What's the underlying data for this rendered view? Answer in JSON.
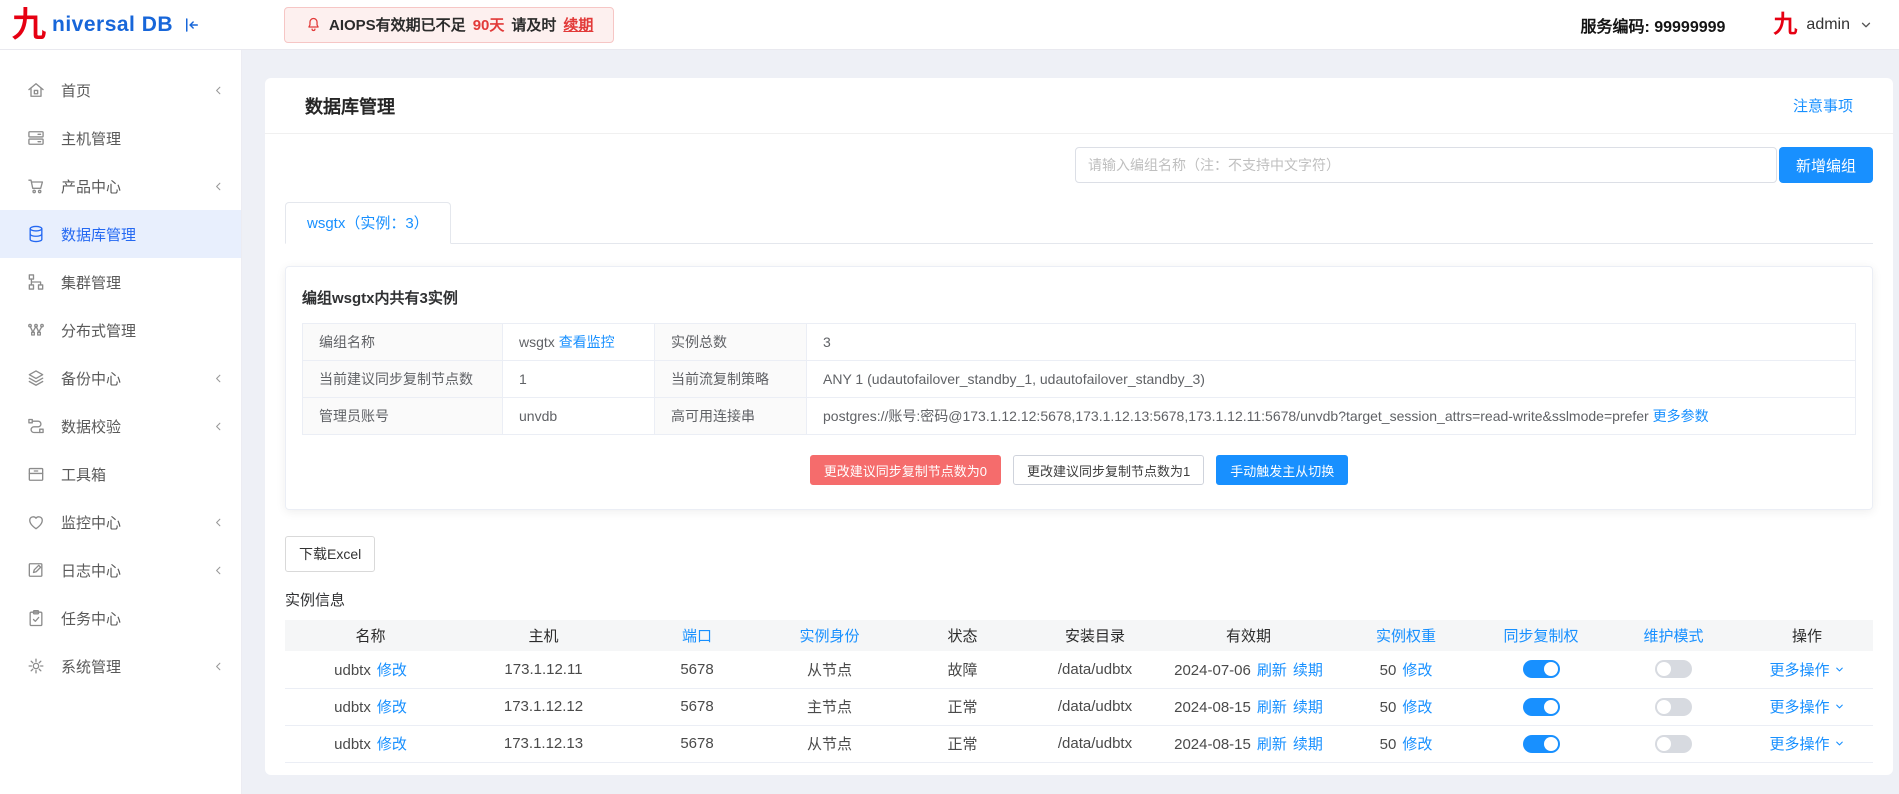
{
  "brand": {
    "logo_han": "九",
    "logo_text": "niversal DB"
  },
  "topbar": {
    "warning": {
      "icon": "bell-icon",
      "prefix": "AIOPS有效期已不足",
      "days": "90天",
      "mid": "请及时",
      "renew": "续期"
    },
    "service_code": "服务编码: 99999999",
    "user": {
      "logo_han": "九",
      "name": "admin"
    }
  },
  "sidebar": {
    "items": [
      {
        "id": "home",
        "label": "首页",
        "icon": "home-icon",
        "expandable": true,
        "active": false
      },
      {
        "id": "hosts",
        "label": "主机管理",
        "icon": "server-icon",
        "expandable": false,
        "active": false
      },
      {
        "id": "products",
        "label": "产品中心",
        "icon": "cart-icon",
        "expandable": true,
        "active": false
      },
      {
        "id": "databases",
        "label": "数据库管理",
        "icon": "database-icon",
        "expandable": false,
        "active": true
      },
      {
        "id": "clusters",
        "label": "集群管理",
        "icon": "cluster-icon",
        "expandable": false,
        "active": false
      },
      {
        "id": "distributed",
        "label": "分布式管理",
        "icon": "distributed-icon",
        "expandable": false,
        "active": false
      },
      {
        "id": "backup",
        "label": "备份中心",
        "icon": "layers-icon",
        "expandable": true,
        "active": false
      },
      {
        "id": "validation",
        "label": "数据校验",
        "icon": "flow-icon",
        "expandable": true,
        "active": false
      },
      {
        "id": "toolbox",
        "label": "工具箱",
        "icon": "toolbox-icon",
        "expandable": false,
        "active": false
      },
      {
        "id": "monitoring",
        "label": "监控中心",
        "icon": "heart-icon",
        "expandable": true,
        "active": false
      },
      {
        "id": "logs",
        "label": "日志中心",
        "icon": "edit-icon",
        "expandable": true,
        "active": false
      },
      {
        "id": "tasks",
        "label": "任务中心",
        "icon": "clipboard-icon",
        "expandable": false,
        "active": false
      },
      {
        "id": "system",
        "label": "系统管理",
        "icon": "gear-icon",
        "expandable": true,
        "active": false
      }
    ]
  },
  "page": {
    "title": "数据库管理",
    "notice_link": "注意事项",
    "search": {
      "placeholder": "请输入编组名称（注：不支持中文字符）",
      "value": ""
    },
    "add_group_button": "新增编组",
    "tabs": [
      {
        "label": "wsgtx（实例：3）",
        "active": true
      }
    ],
    "group_panel": {
      "title": "编组wsgtx内共有3实例",
      "info_rows": [
        {
          "label1": "编组名称",
          "value1": "wsgtx",
          "value1_link": "查看监控",
          "label2": "实例总数",
          "value2": "3",
          "value2_link": ""
        },
        {
          "label1": "当前建议同步复制节点数",
          "value1": "1",
          "value1_link": "",
          "label2": "当前流复制策略",
          "value2": "ANY 1 (udautofailover_standby_1, udautofailover_standby_3)",
          "value2_link": ""
        },
        {
          "label1": "管理员账号",
          "value1": "unvdb",
          "value1_link": "",
          "label2": "高可用连接串",
          "value2": "postgres://账号:密码@173.1.12.12:5678,173.1.12.13:5678,173.1.12.11:5678/unvdb?target_session_attrs=read-write&sslmode=prefer",
          "value2_link": "更多参数"
        }
      ],
      "action_buttons": [
        {
          "label": "更改建议同步复制节点数为0",
          "style": "danger",
          "name": "set-sync-nodes-0-button"
        },
        {
          "label": "更改建议同步复制节点数为1",
          "style": "plain",
          "name": "set-sync-nodes-1-button"
        },
        {
          "label": "手动触发主从切换",
          "style": "primary",
          "name": "manual-failover-button"
        }
      ]
    },
    "download_excel_button": "下载Excel",
    "instance_section": {
      "title": "实例信息",
      "columns": [
        {
          "label": "名称",
          "accent": false
        },
        {
          "label": "主机",
          "accent": false
        },
        {
          "label": "端口",
          "accent": true
        },
        {
          "label": "实例身份",
          "accent": true
        },
        {
          "label": "状态",
          "accent": false
        },
        {
          "label": "安装目录",
          "accent": false
        },
        {
          "label": "有效期",
          "accent": false
        },
        {
          "label": "实例权重",
          "accent": true
        },
        {
          "label": "同步复制权",
          "accent": true
        },
        {
          "label": "维护模式",
          "accent": true
        },
        {
          "label": "操作",
          "accent": false
        }
      ],
      "rows": [
        {
          "name": "udbtx",
          "modify_link": "修改",
          "host": "173.1.12.11",
          "port": "5678",
          "role": "从节点",
          "status": "故障",
          "install_dir": "/data/udbtx",
          "expiry": "2024-07-06",
          "refresh_link": "刷新",
          "renew_link": "续期",
          "weight": "50",
          "weight_modify_link": "修改",
          "sync_replication_on": true,
          "maintenance_on": false,
          "more_actions": "更多操作"
        },
        {
          "name": "udbtx",
          "modify_link": "修改",
          "host": "173.1.12.12",
          "port": "5678",
          "role": "主节点",
          "status": "正常",
          "install_dir": "/data/udbtx",
          "expiry": "2024-08-15",
          "refresh_link": "刷新",
          "renew_link": "续期",
          "weight": "50",
          "weight_modify_link": "修改",
          "sync_replication_on": true,
          "maintenance_on": false,
          "more_actions": "更多操作"
        },
        {
          "name": "udbtx",
          "modify_link": "修改",
          "host": "173.1.12.13",
          "port": "5678",
          "role": "从节点",
          "status": "正常",
          "install_dir": "/data/udbtx",
          "expiry": "2024-08-15",
          "refresh_link": "刷新",
          "renew_link": "续期",
          "weight": "50",
          "weight_modify_link": "修改",
          "sync_replication_on": true,
          "maintenance_on": false,
          "more_actions": "更多操作"
        }
      ]
    }
  },
  "colors": {
    "accent": "#1890ff",
    "danger": "#f56c6c",
    "logo_red": "#e60012",
    "logo_blue": "#1766d9",
    "warning_red": "#e23a39"
  }
}
